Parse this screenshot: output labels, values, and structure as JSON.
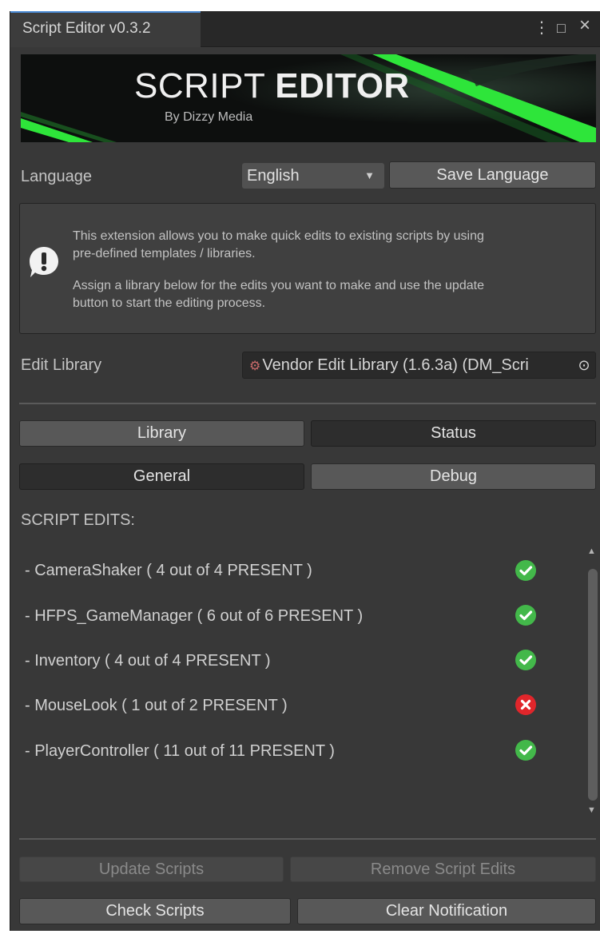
{
  "window": {
    "tab_title": "Script Editor v0.3.2",
    "controls": {
      "menu": "⋮",
      "maximize": "□",
      "close": "×"
    }
  },
  "banner": {
    "title_light": "SCRIPT ",
    "title_bold": "EDITOR",
    "subtitle": "By Dizzy Media",
    "accent_color": "#2ee53a"
  },
  "language": {
    "label": "Language",
    "selected": "English",
    "save_button": "Save Language"
  },
  "help": {
    "icon": "warning-icon",
    "paragraph1_line1": "This extension allows you to make quick edits to existing scripts by using",
    "paragraph1_line2": "pre-defined templates / libraries.",
    "paragraph2_line1": "Assign a library below for the edits you want to make and use the update",
    "paragraph2_line2": "button to start the editing process."
  },
  "edit_library": {
    "label": "Edit Library",
    "value": "Vendor Edit Library (1.6.3a) (DM_Scri",
    "picker_icon": "⊙"
  },
  "tabs_row1": {
    "library": "Library",
    "status": "Status"
  },
  "tabs_row2": {
    "general": "General",
    "debug": "Debug"
  },
  "script_edits": {
    "heading": "SCRIPT EDITS:",
    "items": [
      {
        "text": "- CameraShaker ( 4 out of 4 PRESENT )",
        "status": "ok"
      },
      {
        "text": "- HFPS_GameManager ( 6 out of 6 PRESENT )",
        "status": "ok"
      },
      {
        "text": "- Inventory ( 4 out of 4 PRESENT )",
        "status": "ok"
      },
      {
        "text": "- MouseLook ( 1 out of 2 PRESENT )",
        "status": "error"
      },
      {
        "text": "- PlayerController ( 11 out of 11 PRESENT )",
        "status": "ok"
      }
    ],
    "ok_color": "#43b84a",
    "error_color": "#e0262b"
  },
  "actions": {
    "update_scripts": "Update Scripts",
    "remove_script_edits": "Remove Script Edits",
    "check_scripts": "Check Scripts",
    "clear_notification": "Clear Notification"
  }
}
